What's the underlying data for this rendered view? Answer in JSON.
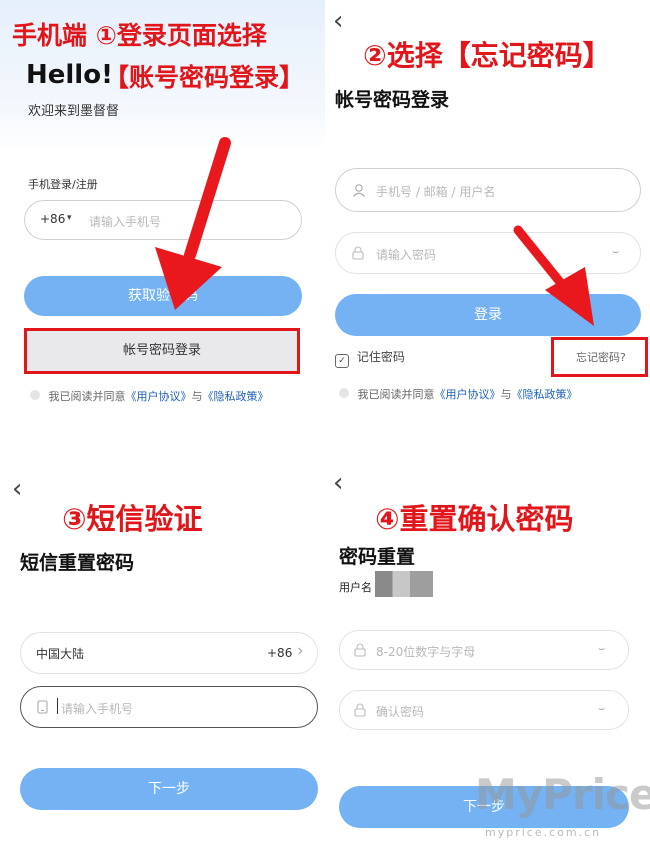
{
  "panel1": {
    "step_label": "手机端 ①登录页面选择",
    "step_label2": "【账号密码登录】",
    "hello": "Hello!",
    "welcome": "欢迎来到墨督督",
    "section_label": "手机登录/注册",
    "country_code": "+86",
    "phone_placeholder": "请输入手机号",
    "get_code_button": "获取验证码",
    "account_login_button": "帐号密码登录",
    "agree_prefix": "我已阅读并同意",
    "user_agreement": "《用户协议》",
    "and": "与",
    "privacy_policy": "《隐私政策》"
  },
  "panel2": {
    "step_label": "②选择【忘记密码】",
    "title": "帐号密码登录",
    "account_placeholder": "手机号 / 邮箱 / 用户名",
    "password_placeholder": "请输入密码",
    "login_button": "登录",
    "remember_label": "记住密码",
    "forgot_link": "忘记密码?",
    "agree_prefix": "我已阅读并同意",
    "user_agreement": "《用户协议》",
    "and": "与",
    "privacy_policy": "《隐私政策》"
  },
  "panel3": {
    "step_label": "③短信验证",
    "title": "短信重置密码",
    "region": "中国大陆",
    "country_code": "+86",
    "phone_placeholder": "请输入手机号",
    "next_button": "下一步"
  },
  "panel4": {
    "step_label": "④重置确认密码",
    "title": "密码重置",
    "username_label": "用户名",
    "new_password_placeholder": "8-20位数字与字母",
    "confirm_password_placeholder": "确认密码",
    "next_button": "下一步",
    "watermark": "MyPrice",
    "watermark_url": "myprice.com.cn"
  },
  "colors": {
    "accent_blue": "#74b2f3",
    "annotation_red": "#e0161b",
    "link_blue": "#1a5fb4"
  }
}
